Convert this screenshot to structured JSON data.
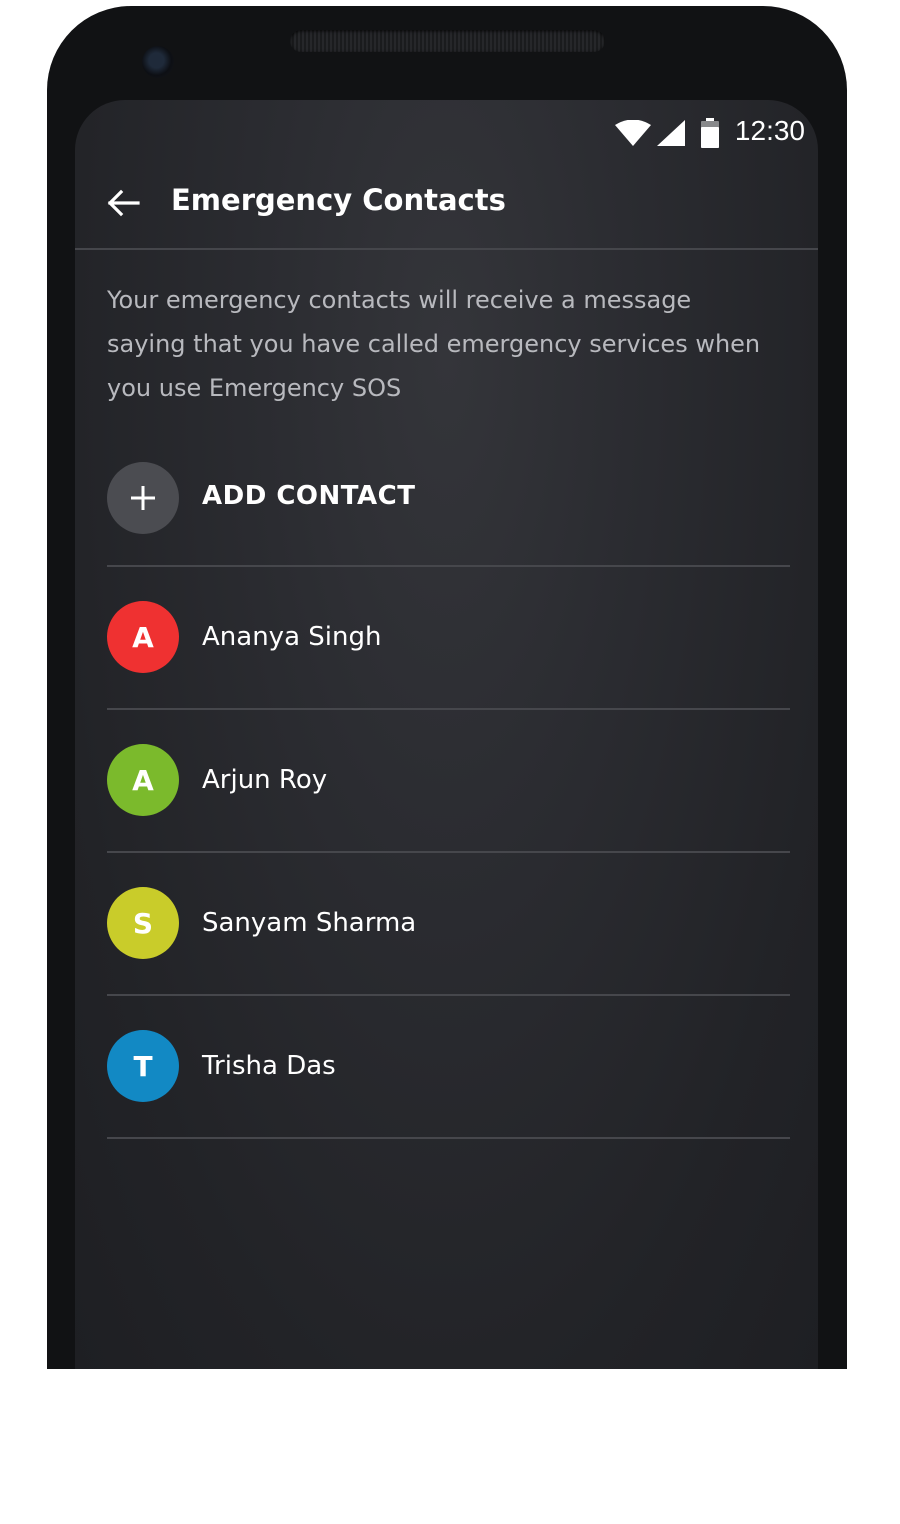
{
  "status_bar": {
    "time": "12:30",
    "icons": [
      "wifi-icon",
      "signal-icon",
      "battery-icon"
    ]
  },
  "toolbar": {
    "back_icon": "arrow-left-icon",
    "title": "Emergency Contacts"
  },
  "description": "Your emergency contacts will receive a message saying that you have called emergency services when you use Emergency SOS",
  "add_contact": {
    "icon": "plus-icon",
    "label": "ADD CONTACT"
  },
  "contacts": [
    {
      "initial": "A",
      "name": "Ananya Singh",
      "color": "#ef3131"
    },
    {
      "initial": "A",
      "name": "Arjun Roy",
      "color": "#7bba2c"
    },
    {
      "initial": "S",
      "name": "Sanyam Sharma",
      "color": "#c9cc2a"
    },
    {
      "initial": "T",
      "name": "Trisha Das",
      "color": "#1289c4"
    }
  ],
  "theme": {
    "background": "#2b2c31",
    "text_primary": "#ffffff",
    "text_secondary": "#b8b9be",
    "add_button_bg": "#4b4c51"
  }
}
